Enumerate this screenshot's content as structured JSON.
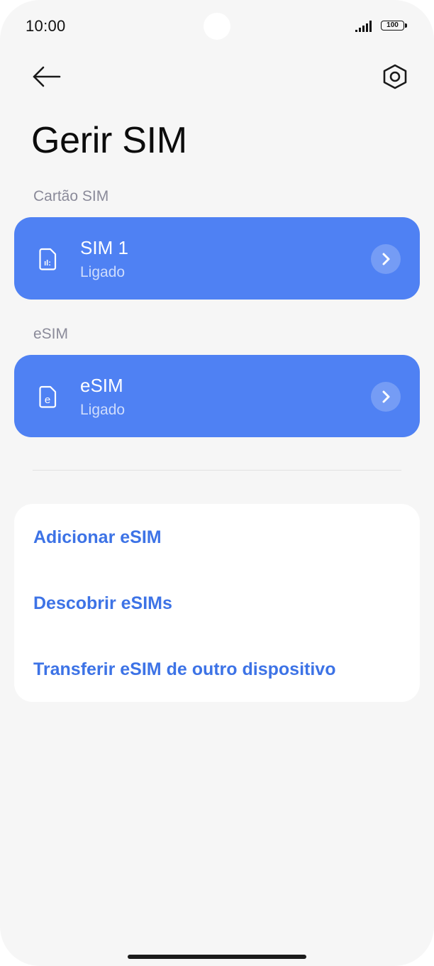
{
  "status_bar": {
    "time": "10:00",
    "battery": "100",
    "signal_icon": "signal-bars-icon"
  },
  "header": {
    "back_icon": "arrow-left-icon",
    "settings_icon": "gear-hexagon-icon"
  },
  "page": {
    "title": "Gerir SIM"
  },
  "sections": {
    "sim_card_label": "Cartão SIM",
    "esim_label": "eSIM"
  },
  "sims": [
    {
      "name": "SIM 1",
      "status": "Ligado",
      "icon": "sim-card-icon"
    },
    {
      "name": "eSIM",
      "status": "Ligado",
      "icon": "esim-icon"
    }
  ],
  "actions": [
    {
      "label": "Adicionar eSIM"
    },
    {
      "label": "Descobrir eSIMs"
    },
    {
      "label": "Transferir eSIM de outro dispositivo"
    }
  ],
  "colors": {
    "background": "#f6f6f6",
    "card_blue": "#4f81f3",
    "link_blue": "#3d73e6",
    "section_label": "#8a8a99"
  }
}
